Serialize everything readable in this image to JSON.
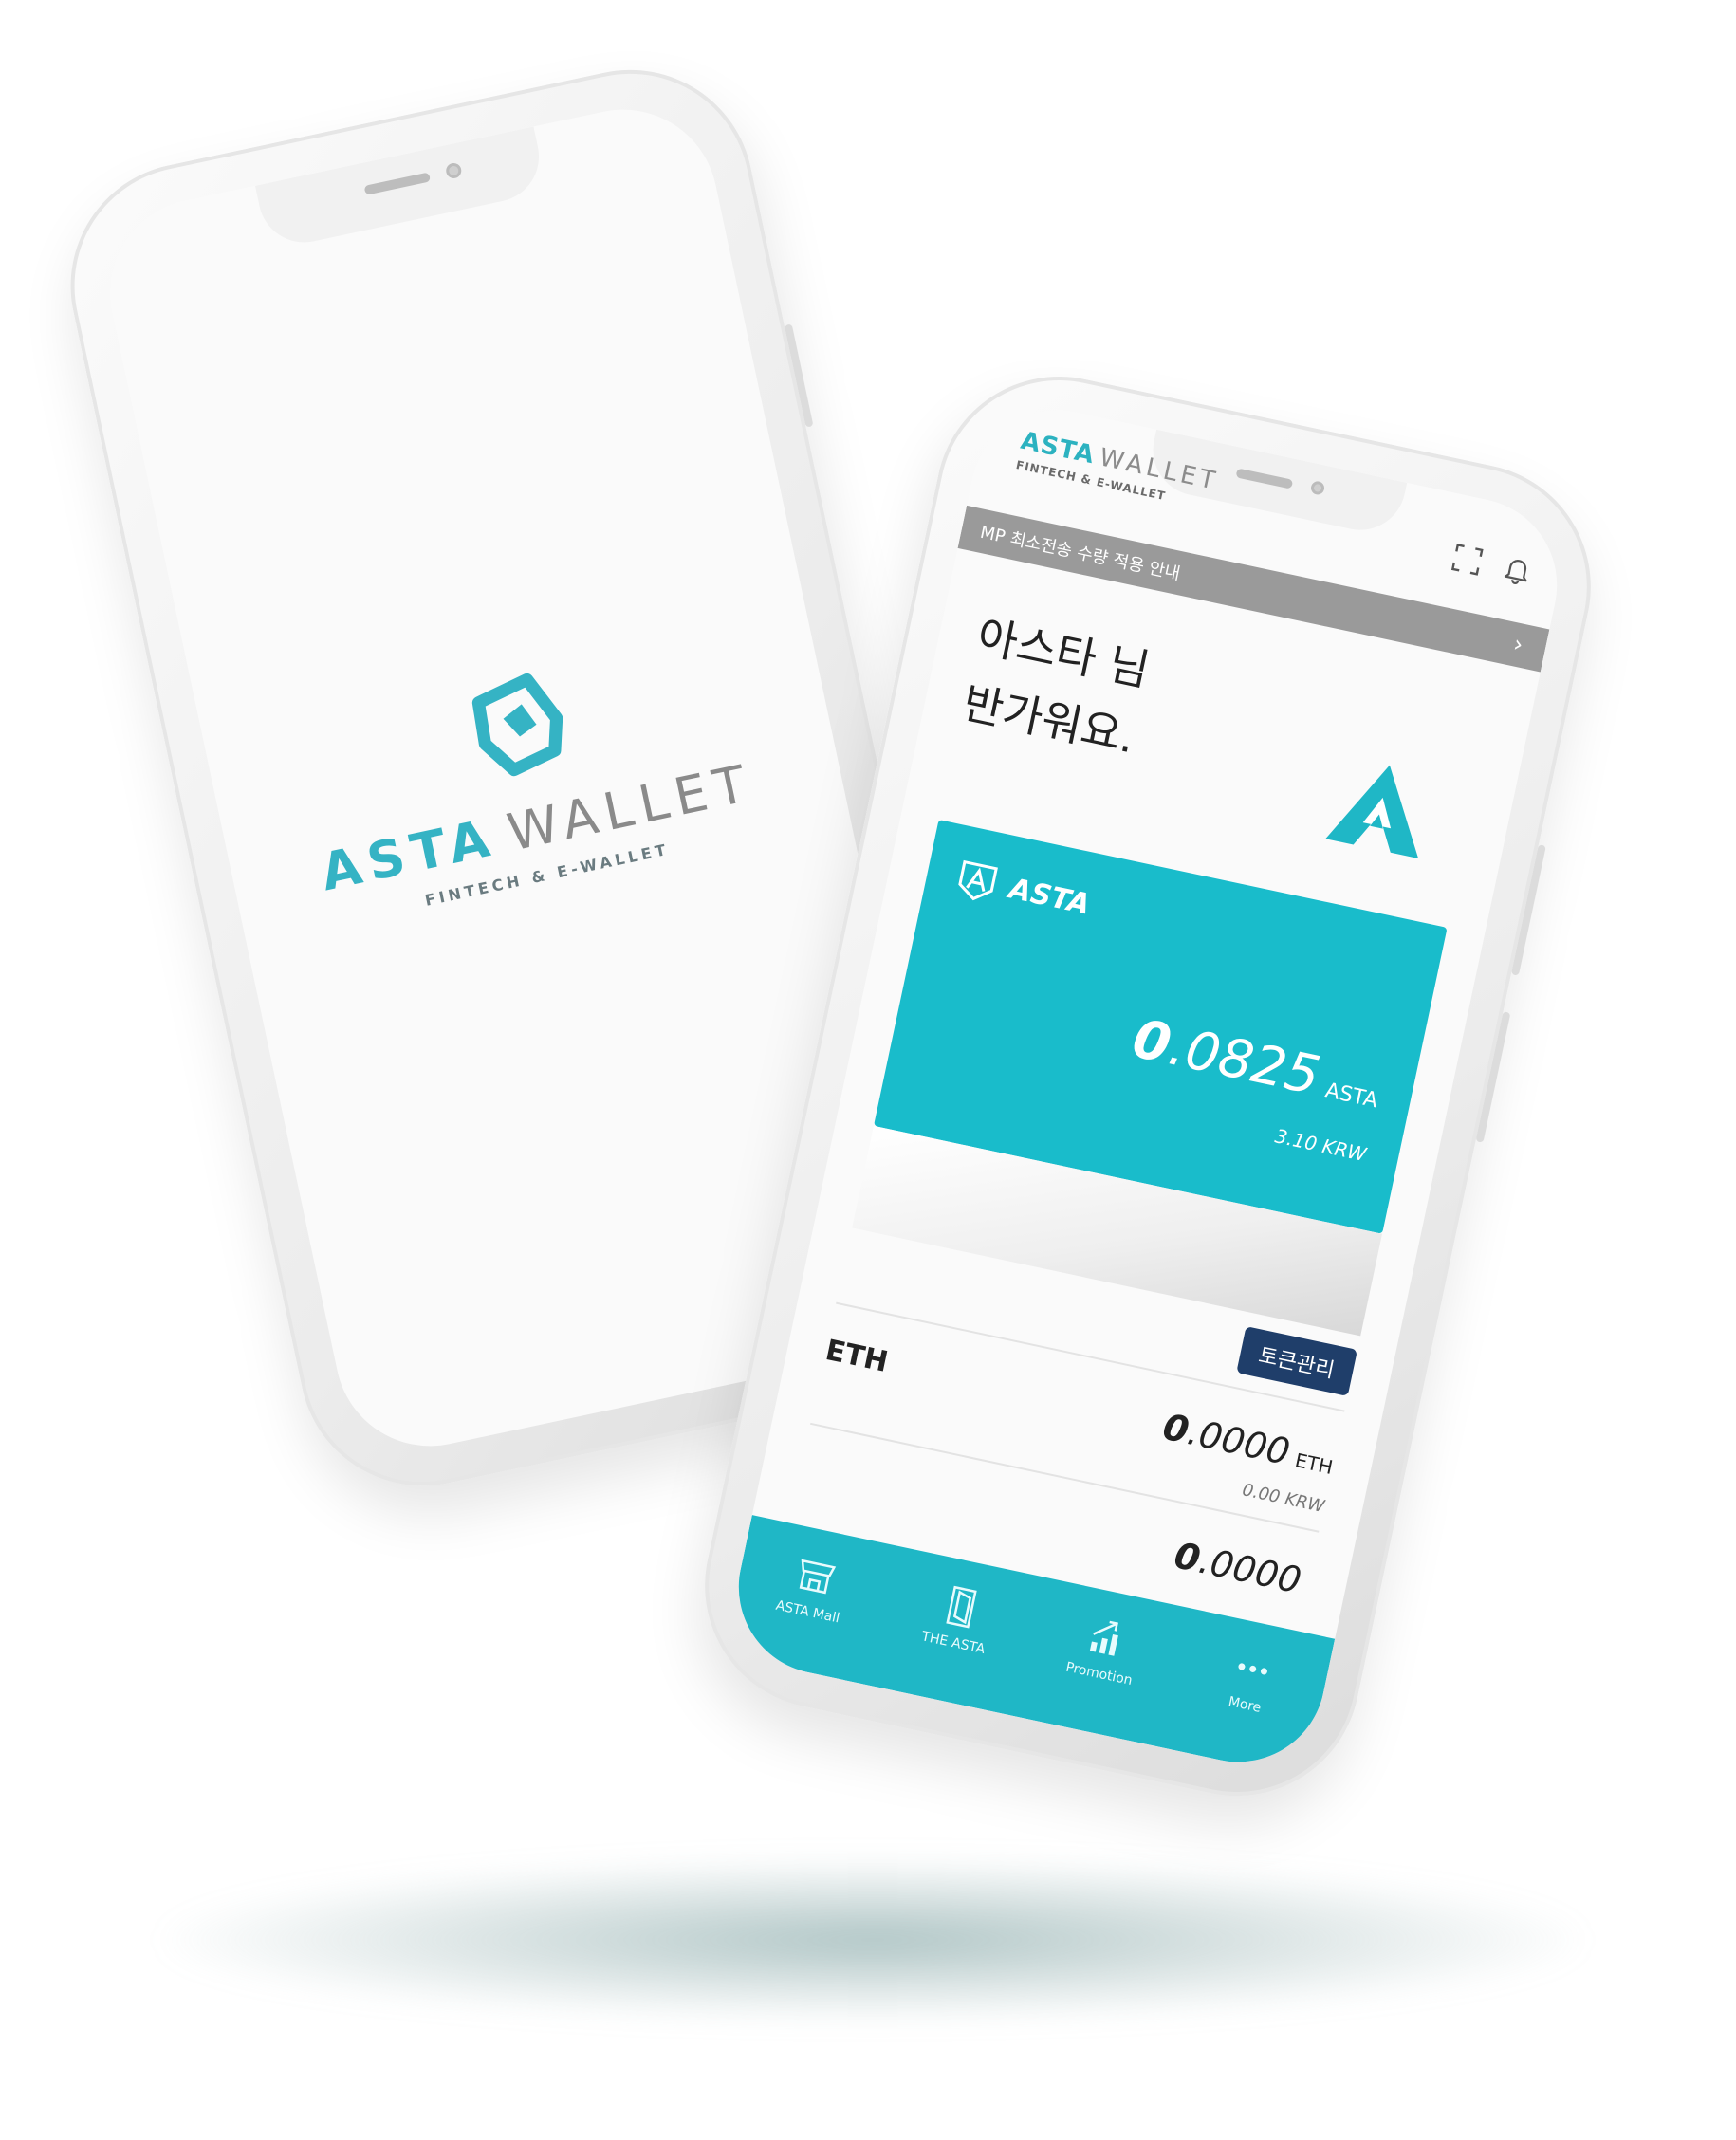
{
  "splash": {
    "brand_primary": "ASTA",
    "brand_secondary": "WALLET",
    "tagline": "FINTECH & E-WALLET"
  },
  "header": {
    "brand_primary": "ASTA",
    "brand_secondary": "WALLET",
    "tagline": "FINTECH & E-WALLET",
    "icons": [
      "scan-icon",
      "bell-icon"
    ]
  },
  "notice": {
    "text": "MP 최소전송 수량 적용 안내",
    "chevron": "›"
  },
  "greeting": {
    "line1": "아스타 님",
    "line2": "반가워요."
  },
  "card": {
    "token": "ASTA",
    "amount_int": "0",
    "amount_frac": ".0825",
    "unit": "ASTA",
    "krw": "3.10 KRW"
  },
  "token_manage_label": "토큰관리",
  "tokens": [
    {
      "symbol": "ETH",
      "amount_int": "0",
      "amount_frac": ".0000",
      "unit": "ETH",
      "krw": "0.00 KRW"
    },
    {
      "symbol": "",
      "amount_int": "0",
      "amount_frac": ".0000",
      "unit": "",
      "krw": ""
    }
  ],
  "tabs": [
    {
      "label": "ASTA Mall",
      "icon": "store-icon"
    },
    {
      "label": "THE ASTA",
      "icon": "door-icon"
    },
    {
      "label": "Promotion",
      "icon": "chart-up-icon"
    },
    {
      "label": "More",
      "icon": "more-dots-icon"
    }
  ],
  "colors": {
    "accent": "#1fb7c6",
    "card": "#19bccb",
    "button": "#1f3e6a",
    "notice_bar": "#9a9a9a"
  }
}
